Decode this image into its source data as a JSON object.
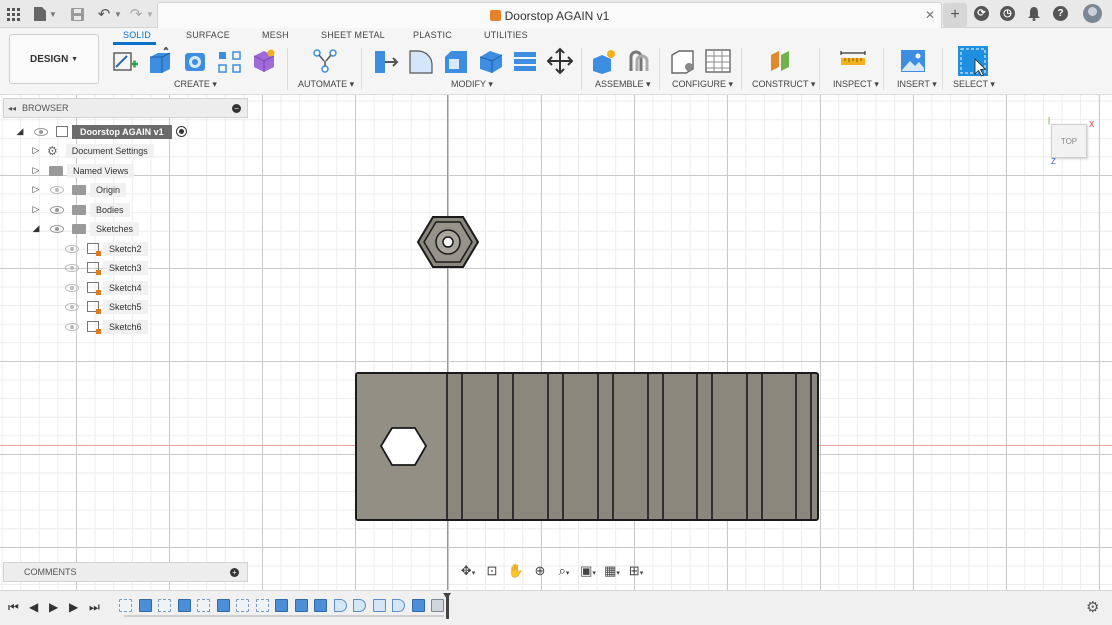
{
  "window": {
    "document_title": "Doorstop AGAIN v1"
  },
  "ribbon": {
    "workspace": "DESIGN",
    "tabs": [
      "SOLID",
      "SURFACE",
      "MESH",
      "SHEET METAL",
      "PLASTIC",
      "UTILITIES"
    ],
    "active_tab": "SOLID",
    "groups": [
      "CREATE",
      "AUTOMATE",
      "MODIFY",
      "ASSEMBLE",
      "CONFIGURE",
      "CONSTRUCT",
      "INSPECT",
      "INSERT",
      "SELECT"
    ]
  },
  "browser": {
    "title": "BROWSER",
    "root": "Doorstop AGAIN v1",
    "items": [
      {
        "label": "Document Settings"
      },
      {
        "label": "Named Views"
      },
      {
        "label": "Origin"
      },
      {
        "label": "Bodies"
      },
      {
        "label": "Sketches"
      }
    ],
    "sketches": [
      "Sketch2",
      "Sketch3",
      "Sketch4",
      "Sketch5",
      "Sketch6"
    ]
  },
  "comments": {
    "title": "COMMENTS"
  },
  "viewcube": {
    "face_label": "TOP",
    "axis_x": "X",
    "axis_z": "Z"
  },
  "colors": {
    "accent": "#0a70c9",
    "body_fill": "#8a877d",
    "body_edge": "#1a1a1a",
    "axis_blue": "#8e8edf",
    "axis_red": "#e7a7a7"
  },
  "icons": {
    "app_grid": "app-grid-icon",
    "file": "file-icon",
    "save": "save-icon",
    "undo": "undo-icon",
    "redo": "redo-icon",
    "settings": "gear-icon"
  }
}
